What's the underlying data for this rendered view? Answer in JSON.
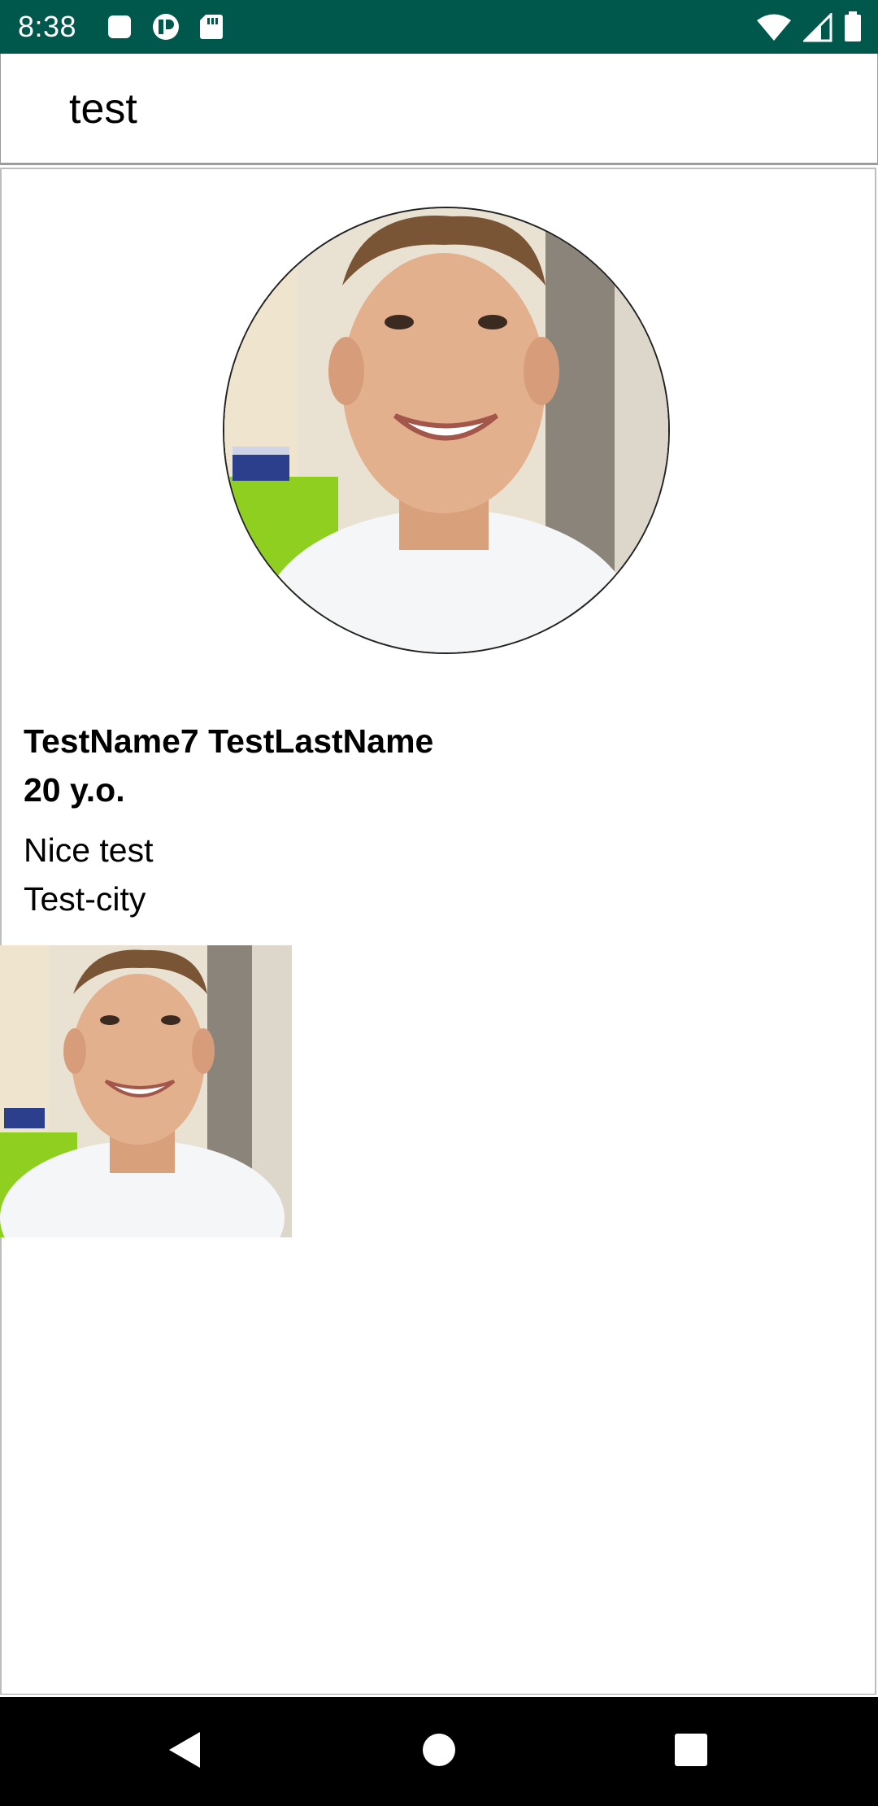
{
  "status_bar": {
    "time": "8:38",
    "left_icons": [
      "notification-square-icon",
      "app-notification-icon",
      "sd-card-icon"
    ],
    "right_icons": [
      "wifi-icon",
      "cell-signal-icon",
      "battery-icon"
    ],
    "background_color": "#00574b"
  },
  "app_bar": {
    "title": "test"
  },
  "profile": {
    "name": "TestName7 TestLastName",
    "age": "20 y.o.",
    "description": "Nice test",
    "city": "Test-city",
    "avatar": "profile-photo"
  },
  "gallery": {
    "photos": [
      "profile-photo"
    ]
  },
  "nav_bar": {
    "buttons": [
      "back-icon",
      "home-icon",
      "recents-icon"
    ]
  }
}
